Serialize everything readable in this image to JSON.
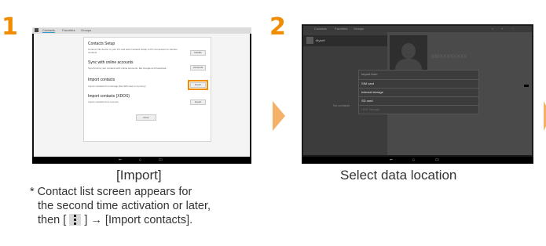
{
  "steps": [
    {
      "number": "1",
      "caption": "[Import]",
      "note": {
        "line1": "* Contact list screen appears for",
        "line2": "the second time activation or later,",
        "line3_pre": "then [",
        "line3_post": "] → [Import contacts]."
      },
      "tablet": {
        "tabs": [
          "Contacts",
          "Favorites",
          "Groups"
        ],
        "dialog": {
          "setup_title": "Contacts Setup",
          "setup_desc": "Connect this device to your PC and start Contacts Setup to PC Companion to transfer",
          "setup_desc2": "contacts.",
          "setup_button": "Details",
          "sync_title": "Sync with online accounts",
          "sync_desc": "Synchronize your contacts with online accounts, like Google and Facebook",
          "sync_button": "Accounts",
          "import_title": "Import contacts",
          "import_desc": "Import contacts from storage (like SIM card or memory)",
          "import_button": "Import",
          "import_accent": "#f08c00",
          "xdos_title": "Import contacts (XDOS)",
          "xdos_desc": "Import contacts from a server",
          "xdos_button": "Import",
          "done_button": "Done"
        },
        "nav": [
          "⭠",
          "⌂",
          "▭"
        ]
      }
    },
    {
      "number": "2",
      "caption": "Select data location",
      "tablet": {
        "tabs": [
          "Contacts",
          "Favorites",
          "Groups"
        ],
        "contact_name": "Myself",
        "no_contacts": "No contacts",
        "phone_number": "080XXXXXXXX",
        "popup": {
          "title": "Import from",
          "options": [
            "SIM card",
            "Internal storage",
            "SD card"
          ],
          "disabled_option": "USB Storage"
        },
        "nav": [
          "⭠",
          "⌂",
          "▭"
        ]
      }
    }
  ],
  "colors": {
    "step_number": "#f08c00",
    "arrow": "#f5b168"
  }
}
